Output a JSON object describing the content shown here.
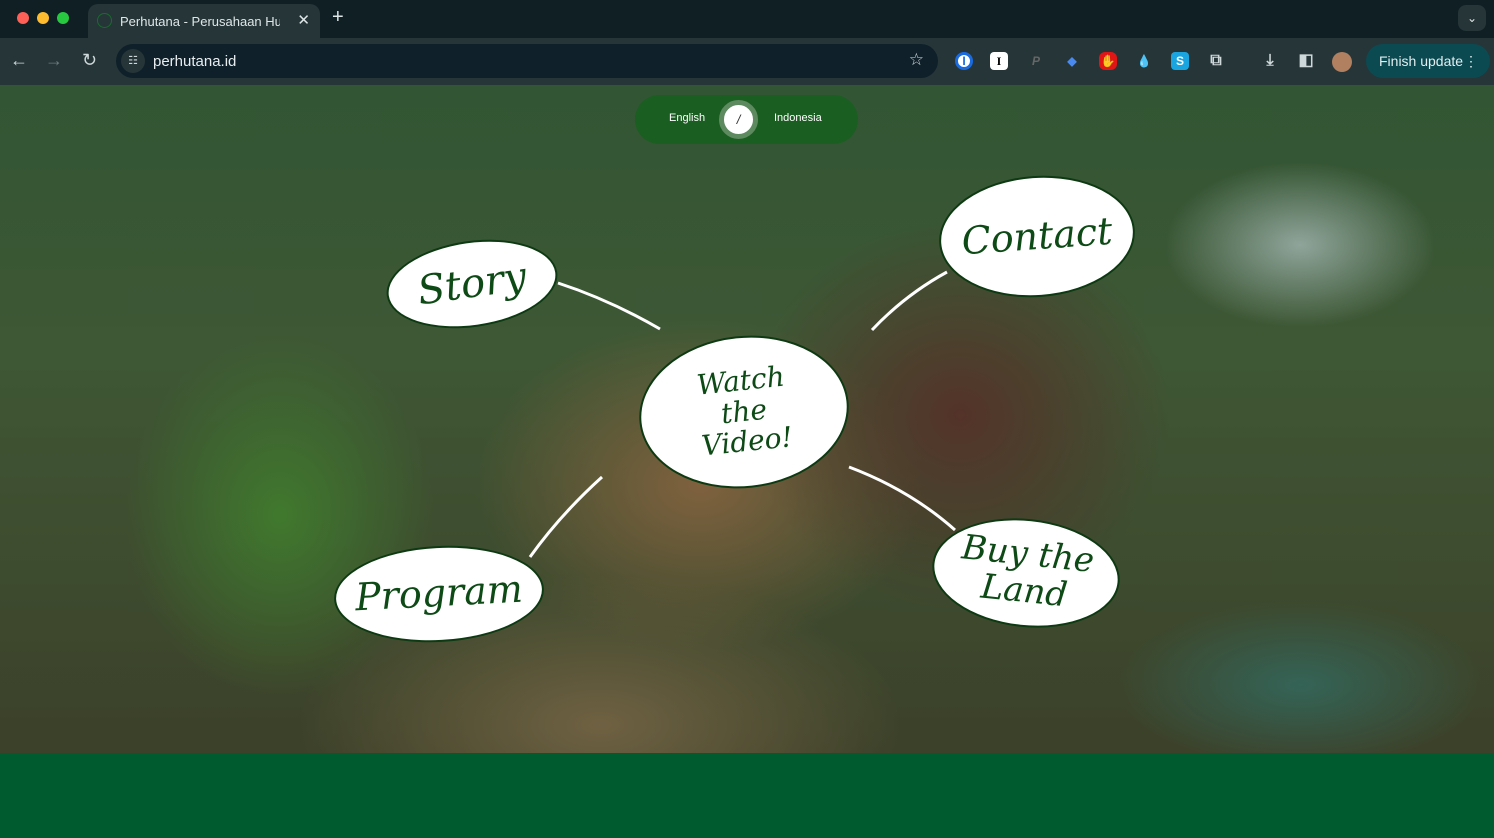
{
  "browser": {
    "tab_title": "Perhutana - Perusahaan Hutan",
    "url": "perhutana.id",
    "finish_update": "Finish update",
    "extensions": [
      "1password-icon",
      "instapaper-icon",
      "paypal-icon",
      "ext-blue-icon",
      "adblock-icon",
      "drop-icon",
      "s-icon",
      "puzzle-icon"
    ]
  },
  "language": {
    "english": "English",
    "separator": "/",
    "indonesia": "Indonesia"
  },
  "bubbles": {
    "story": "Story",
    "contact": "Contact",
    "watch_line1": "Watch",
    "watch_line2": "the",
    "watch_line3": "Video!",
    "program": "Program",
    "buy_line1": "Buy the",
    "buy_line2": "Land"
  },
  "colors": {
    "brand_green": "#1b5e22",
    "footer": "#005c2e",
    "bubble_text": "#0d4a16"
  }
}
